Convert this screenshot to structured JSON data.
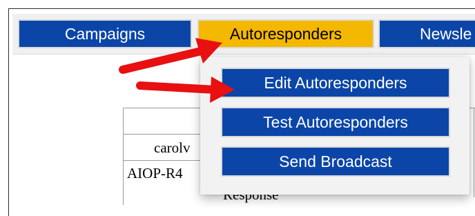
{
  "nav": {
    "tabs": [
      {
        "label": "Campaigns",
        "active": false
      },
      {
        "label": "Autoresponders",
        "active": true
      },
      {
        "label": "Newsle",
        "active": false
      }
    ]
  },
  "dropdown": {
    "items": [
      {
        "label": "Edit Autoresponders"
      },
      {
        "label": "Test Autoresponders"
      },
      {
        "label": "Send Broadcast"
      }
    ]
  },
  "background": {
    "cells": [
      "carolv",
      "AIOP-R4",
      "Response"
    ]
  },
  "colors": {
    "tab_blue": "#0b45a8",
    "tab_active": "#f5b800",
    "arrow_red": "#e81010"
  }
}
